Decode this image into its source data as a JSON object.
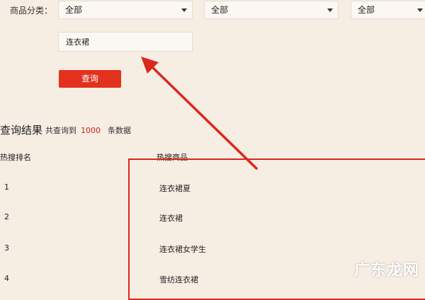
{
  "filter": {
    "label": "商品分类：",
    "selects": [
      "全部",
      "全部",
      "全部"
    ]
  },
  "search": {
    "value": "连衣裙"
  },
  "query_button_label": "查询",
  "results": {
    "title": "查询结果",
    "summary_prefix": "共查询到",
    "count": "1000",
    "summary_suffix": "条数据"
  },
  "table": {
    "headers": [
      "热搜排名",
      "热搜商品"
    ],
    "rows": [
      {
        "rank": "1",
        "product": "连衣裙夏"
      },
      {
        "rank": "2",
        "product": "连衣裙"
      },
      {
        "rank": "3",
        "product": "连衣裙女学生"
      },
      {
        "rank": "4",
        "product": "雪纺连衣裙"
      }
    ]
  },
  "watermark": "广东龙网",
  "colors": {
    "accent": "#e2321d",
    "background": "#f6ede3",
    "annotation": "#d9281e"
  }
}
